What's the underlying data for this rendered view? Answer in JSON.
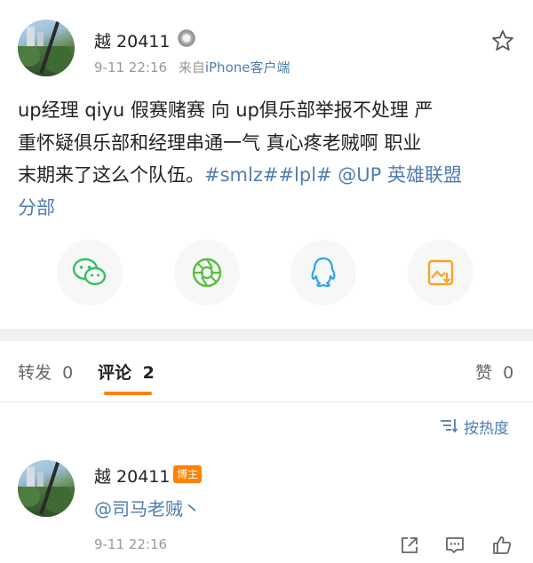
{
  "post": {
    "author": "越 20411",
    "time": "9-11 22:16",
    "source_prefix": "来自",
    "source": "iPhone客户端",
    "text_line1": "up经理 qiyu 假赛赌赛 向 up俱乐部举报不处理 严",
    "text_line2": "重怀疑俱乐部和经理串通一气 真心疼老贼啊 职业",
    "text_line3_plain": "末期来了这么个队伍。",
    "text_line3_link": "#smlz##lpl# @UP 英雄联盟",
    "text_line4_link": "分部"
  },
  "share": {
    "icons": [
      "wechat-icon",
      "moments-icon",
      "qq-icon",
      "save-image-icon"
    ]
  },
  "tabs": {
    "repost_label": "转发",
    "repost_count": "0",
    "comment_label": "评论",
    "comment_count": "2",
    "like_label": "赞",
    "like_count": "0"
  },
  "sort": {
    "label": "按热度"
  },
  "comment": {
    "author": "越 20411",
    "badge": "博主",
    "text": "@司马老贼丶",
    "time": "9-11 22:16"
  },
  "colors": {
    "link": "#507daf",
    "accent": "#ff8200",
    "wechat": "#33c162",
    "moments": "#57be3d",
    "qq": "#2ba7e8",
    "save": "#f5a623"
  }
}
